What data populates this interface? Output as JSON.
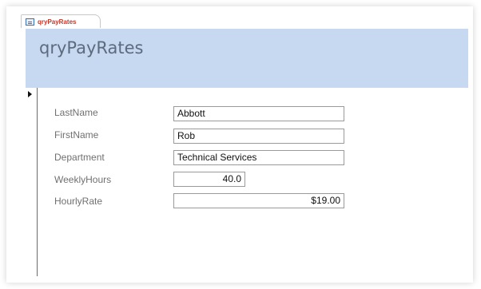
{
  "tab": {
    "label": "qryPayRates",
    "icon": "form-icon"
  },
  "form": {
    "title": "qryPayRates"
  },
  "fields": [
    {
      "label": "LastName",
      "value": "Abbott"
    },
    {
      "label": "FirstName",
      "value": "Rob"
    },
    {
      "label": "Department",
      "value": "Technical Services"
    },
    {
      "label": "WeeklyHours",
      "value": "40.0"
    },
    {
      "label": "HourlyRate",
      "value": "$19.00"
    }
  ],
  "colors": {
    "header_bg": "#c6d9f1",
    "tab_text": "#c0392b",
    "title_text": "#5d6b7e"
  }
}
